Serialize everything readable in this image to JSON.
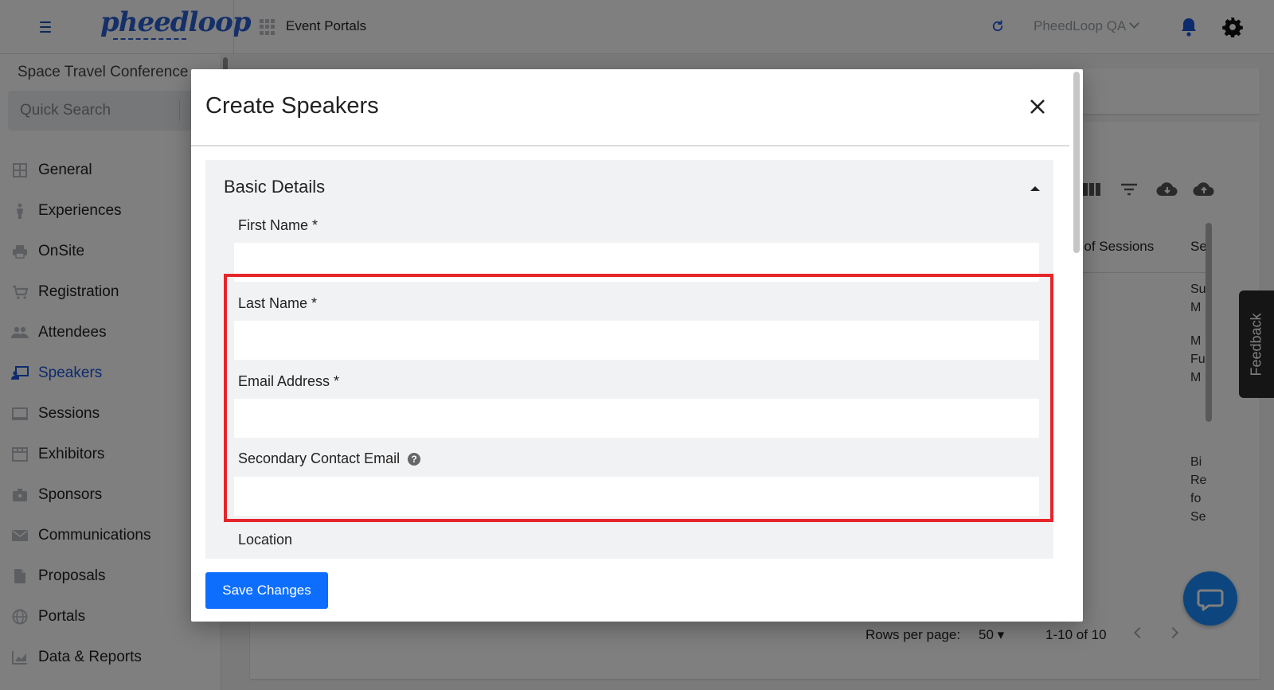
{
  "topbar": {
    "logo": "pheedloop",
    "breadcrumb": "Event Portals",
    "org": "PheedLoop QA"
  },
  "sidebar": {
    "event_name": "Space Travel Conference",
    "search_placeholder": "Quick Search",
    "items": [
      {
        "label": "General"
      },
      {
        "label": "Experiences"
      },
      {
        "label": "OnSite"
      },
      {
        "label": "Registration"
      },
      {
        "label": "Attendees"
      },
      {
        "label": "Speakers",
        "active": true
      },
      {
        "label": "Sessions"
      },
      {
        "label": "Exhibitors"
      },
      {
        "label": "Sponsors"
      },
      {
        "label": "Communications"
      },
      {
        "label": "Proposals"
      },
      {
        "label": "Portals"
      },
      {
        "label": "Data & Reports"
      }
    ]
  },
  "main": {
    "col_header_sessions": "r of Sessions",
    "col_header_next": "Se",
    "truncated_cells": [
      "Su",
      "M",
      "M",
      "Fu",
      "M",
      "Bi",
      "Re",
      "fo",
      "Se"
    ],
    "rows_per_page_label": "Rows per page:",
    "rows_per_page_value": "50",
    "range": "1-10 of 10",
    "feedback": "Feedback"
  },
  "modal": {
    "title": "Create Speakers",
    "section_title": "Basic Details",
    "fields": {
      "first_name": {
        "label": "First Name *",
        "value": ""
      },
      "last_name": {
        "label": "Last Name *",
        "value": ""
      },
      "email": {
        "label": "Email Address *",
        "value": ""
      },
      "secondary_email": {
        "label": "Secondary Contact Email",
        "value": ""
      },
      "location": {
        "label": "Location"
      }
    },
    "help_glyph": "?",
    "save_label": "Save Changes"
  },
  "colors": {
    "accent": "#1a56db",
    "primary_button": "#0d6efd",
    "highlight": "#e5262a",
    "chat": "#1a8cff"
  }
}
